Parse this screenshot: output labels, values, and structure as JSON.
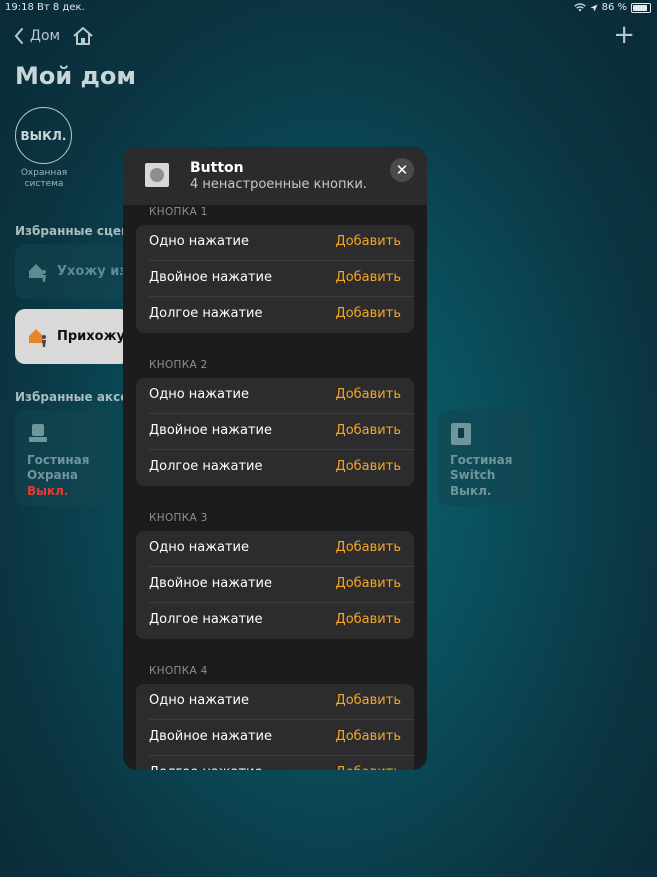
{
  "status_bar": {
    "time": "19:18",
    "date": "Вт 8 дек.",
    "battery": "86 %",
    "battery_level": 0.86
  },
  "nav": {
    "back_label": "Дом"
  },
  "page": {
    "title": "Мой дом"
  },
  "security": {
    "state": "ВЫКЛ.",
    "label": "Охранная система"
  },
  "scenes": {
    "section_label": "Избранные сцена",
    "items": [
      {
        "label": "Ухожу из"
      },
      {
        "label": "Прихожу"
      }
    ]
  },
  "accessories": {
    "section_label": "Избранные аксес",
    "items": [
      {
        "room": "Гостиная",
        "name": "Охрана",
        "status": "Выкл.",
        "status_color": "#e53935"
      },
      {
        "room": "Гостиная",
        "name": "Switch",
        "status": "Выкл.",
        "status_color": "#6f959d"
      }
    ]
  },
  "modal": {
    "title": "Button",
    "subtitle": "4 ненастроенные кнопки.",
    "close_icon": "close-icon",
    "groups": [
      {
        "heading": "КНОПКА 1",
        "rows": [
          {
            "label": "Одно нажатие",
            "action": "Добавить"
          },
          {
            "label": "Двойное нажатие",
            "action": "Добавить"
          },
          {
            "label": "Долгое нажатие",
            "action": "Добавить"
          }
        ]
      },
      {
        "heading": "КНОПКА 2",
        "rows": [
          {
            "label": "Одно нажатие",
            "action": "Добавить"
          },
          {
            "label": "Двойное нажатие",
            "action": "Добавить"
          },
          {
            "label": "Долгое нажатие",
            "action": "Добавить"
          }
        ]
      },
      {
        "heading": "КНОПКА 3",
        "rows": [
          {
            "label": "Одно нажатие",
            "action": "Добавить"
          },
          {
            "label": "Двойное нажатие",
            "action": "Добавить"
          },
          {
            "label": "Долгое нажатие",
            "action": "Добавить"
          }
        ]
      },
      {
        "heading": "КНОПКА 4",
        "rows": [
          {
            "label": "Одно нажатие",
            "action": "Добавить"
          },
          {
            "label": "Двойное нажатие",
            "action": "Добавить"
          },
          {
            "label": "Долгое нажатие",
            "action": "Добавить"
          }
        ]
      }
    ]
  },
  "colors": {
    "accent": "#f5a623",
    "modal_bg": "#1c1c1e",
    "card_bg": "#2c2c2e"
  }
}
